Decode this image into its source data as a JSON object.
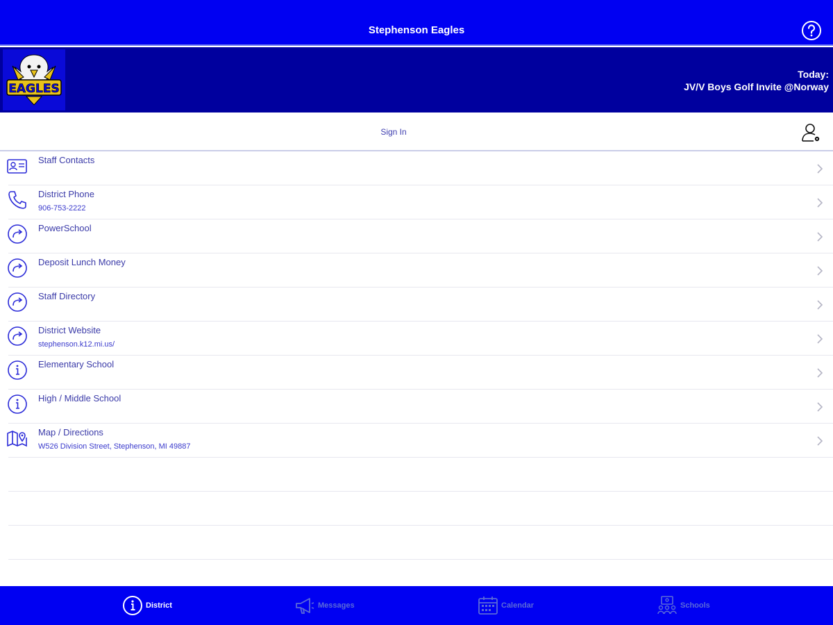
{
  "header": {
    "title": "Stephenson Eagles",
    "help_icon": "help-circle-icon"
  },
  "banner": {
    "logo_text": "EAGLES",
    "today_label": "Today:",
    "today_event": "JV/V Boys Golf Invite @Norway"
  },
  "signin": {
    "label": "Sign In",
    "icon": "user-settings-icon"
  },
  "list": [
    {
      "title": "Staff Contacts",
      "subtitle": "",
      "icon": "contact-card-icon"
    },
    {
      "title": "District Phone",
      "subtitle": "906-753-2222",
      "icon": "phone-icon"
    },
    {
      "title": "PowerSchool",
      "subtitle": "",
      "icon": "link-arrow-icon"
    },
    {
      "title": "Deposit Lunch Money",
      "subtitle": "",
      "icon": "link-arrow-icon"
    },
    {
      "title": "Staff Directory",
      "subtitle": "",
      "icon": "link-arrow-icon"
    },
    {
      "title": "District Website",
      "subtitle": "stephenson.k12.mi.us/",
      "icon": "link-arrow-icon"
    },
    {
      "title": "Elementary School",
      "subtitle": "",
      "icon": "info-icon"
    },
    {
      "title": "High / Middle School",
      "subtitle": "",
      "icon": "info-icon"
    },
    {
      "title": "Map / Directions",
      "subtitle": "W526 Division Street, Stephenson, MI 49887",
      "icon": "map-icon"
    }
  ],
  "tabs": [
    {
      "label": "District",
      "active": true,
      "icon": "info-icon"
    },
    {
      "label": "Messages",
      "active": false,
      "icon": "megaphone-icon"
    },
    {
      "label": "Calendar",
      "active": false,
      "icon": "calendar-icon"
    },
    {
      "label": "Schools",
      "active": false,
      "icon": "schools-icon"
    }
  ],
  "colors": {
    "primary": "#0000f2",
    "banner": "#00009e",
    "text": "#3a3aa8"
  }
}
